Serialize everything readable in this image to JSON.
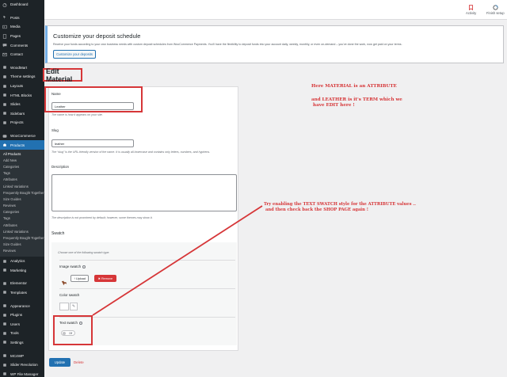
{
  "sidebar": {
    "items": [
      {
        "label": "Dashboard",
        "icon": "dashboard-icon"
      },
      {
        "gap": true
      },
      {
        "label": "Posts",
        "icon": "pin-icon"
      },
      {
        "label": "Media",
        "icon": "media-icon"
      },
      {
        "label": "Pages",
        "icon": "page-icon"
      },
      {
        "label": "Comments",
        "icon": "comment-icon"
      },
      {
        "label": "Contact",
        "icon": "mail-icon"
      },
      {
        "gap": true
      },
      {
        "label": "WoodMart",
        "icon": "woodmart-icon"
      },
      {
        "label": "Theme settings",
        "icon": "settings-icon"
      },
      {
        "label": "Layouts",
        "icon": "layout-icon"
      },
      {
        "label": "HTML Blocks",
        "icon": "blocks-icon"
      },
      {
        "label": "Slides",
        "icon": "slides-icon"
      },
      {
        "label": "Sidebars",
        "icon": "sidebar-icon"
      },
      {
        "label": "Projects",
        "icon": "projects-icon"
      },
      {
        "gap": true
      },
      {
        "label": "WooCommerce",
        "icon": "woocommerce-icon"
      },
      {
        "label": "Products",
        "icon": "products-icon",
        "active": true
      }
    ],
    "submenu": [
      {
        "label": "All Products"
      },
      {
        "label": "Add New"
      },
      {
        "label": "Categories"
      },
      {
        "label": "Tags"
      },
      {
        "label": "Attributes"
      },
      {
        "label": "Linked Variations"
      },
      {
        "label": "Frequently Bought Together",
        "wrap": true
      },
      {
        "label": "Size Guides"
      },
      {
        "label": "Reviews"
      },
      {
        "label": "Categories"
      },
      {
        "label": "Tags"
      },
      {
        "label": "Attributes"
      },
      {
        "label": "Linked Variations"
      },
      {
        "label": "Frequently Bought Together",
        "wrap": true
      },
      {
        "label": "Size Guides"
      },
      {
        "label": "Reviews"
      }
    ],
    "items_bottom": [
      {
        "label": "Analytics",
        "icon": "analytics-icon"
      },
      {
        "label": "Marketing",
        "icon": "marketing-icon"
      },
      {
        "gap": true
      },
      {
        "label": "Elementor",
        "icon": "elementor-icon"
      },
      {
        "label": "Templates",
        "icon": "templates-icon"
      },
      {
        "gap": true
      },
      {
        "label": "Appearance",
        "icon": "appearance-icon"
      },
      {
        "label": "Plugins",
        "icon": "plugins-icon"
      },
      {
        "label": "Users",
        "icon": "users-icon"
      },
      {
        "label": "Tools",
        "icon": "tools-icon"
      },
      {
        "label": "Settings",
        "icon": "settings-icon"
      },
      {
        "gap": true
      },
      {
        "label": "MC4WP",
        "icon": "mc4wp-icon"
      },
      {
        "label": "Slider Revolution",
        "icon": "slider-icon"
      },
      {
        "label": "WP File Manager",
        "icon": "file-manager-icon"
      },
      {
        "label": "Loco Translate",
        "icon": "translate-icon"
      }
    ]
  },
  "topbar": {
    "activity_label": "Activity",
    "finish_setup_label": "Finish setup"
  },
  "notice": {
    "title": "Customize your deposit schedule",
    "text": "Receive your funds according to your own business needs with custom deposit schedules from WooCommerce Payments. You'll have the flexibility to deposit funds into your account daily, weekly, monthly, or even on-demand – you've done the work, now get paid on your terms.",
    "button_label": "Customize your deposits"
  },
  "page": {
    "title": "Edit Material"
  },
  "form": {
    "name_label": "Name",
    "name_value": "Leather",
    "name_help": "The name is how it appears on your site.",
    "slug_label": "Slug",
    "slug_value": "leather",
    "slug_help": "The “slug” is the URL-friendly version of the name. It is usually all lowercase and contains only letters, numbers, and hyphens.",
    "description_label": "Description",
    "description_help": "The description is not prominent by default; however, some themes may show it.",
    "swatch_heading": "Swatch",
    "swatch_hint": "Choose one of the following swatch type.",
    "image_swatch_label": "Image swatch",
    "upload_label": "Upload",
    "remove_label": "Remove",
    "color_swatch_label": "Color swatch",
    "text_swatch_label": "Text swatch",
    "text_swatch_toggle": "Off",
    "update_label": "Update",
    "delete_label": "Delete"
  },
  "annotations": {
    "note1_line1": "Here MATERIAL is an ATTRIBUTE",
    "note1_line2": "and LEATHER is it's TERM which we",
    "note1_line3": "have EDIT here !",
    "note2_line1": "Try enabling the TEXT SWATCH style for the ATTRIBUTE values ..",
    "note2_line2": "and then check back  the SHOP PAGE again !"
  },
  "colors": {
    "sidebar_bg": "#1d2327",
    "active_blue": "#2271b1",
    "annotation_red": "#d63638"
  }
}
